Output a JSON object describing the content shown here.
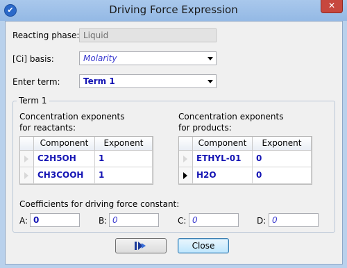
{
  "window": {
    "title": "Driving Force Expression",
    "close_glyph": "✕"
  },
  "form": {
    "reacting_phase": {
      "label": "Reacting phase:",
      "value": "Liquid"
    },
    "ci_basis": {
      "label": "[Ci] basis:",
      "value": "Molarity"
    },
    "enter_term": {
      "label": "Enter term:",
      "value": "Term 1"
    }
  },
  "term_group": {
    "title": "Term 1",
    "reactants": {
      "heading_line1": "Concentration exponents",
      "heading_line2": "for reactants:",
      "columns": [
        "Component",
        "Exponent"
      ],
      "rows": [
        {
          "component": "C2H5OH",
          "exponent": "1"
        },
        {
          "component": "CH3COOH",
          "exponent": "1"
        }
      ]
    },
    "products": {
      "heading_line1": "Concentration exponents",
      "heading_line2": "for products:",
      "columns": [
        "Component",
        "Exponent"
      ],
      "rows": [
        {
          "component": "ETHYL-01",
          "exponent": "0"
        },
        {
          "component": "H2O",
          "exponent": "0"
        }
      ]
    },
    "coefficients": {
      "heading": "Coefficients for driving force constant:",
      "a": {
        "label": "A:",
        "value": "0"
      },
      "b": {
        "label": "B:",
        "value": "0"
      },
      "c": {
        "label": "C:",
        "value": "0"
      },
      "d": {
        "label": "D:",
        "value": "0"
      }
    }
  },
  "buttons": {
    "next_icon": "next-arrow-icon",
    "close_label": "Close"
  }
}
